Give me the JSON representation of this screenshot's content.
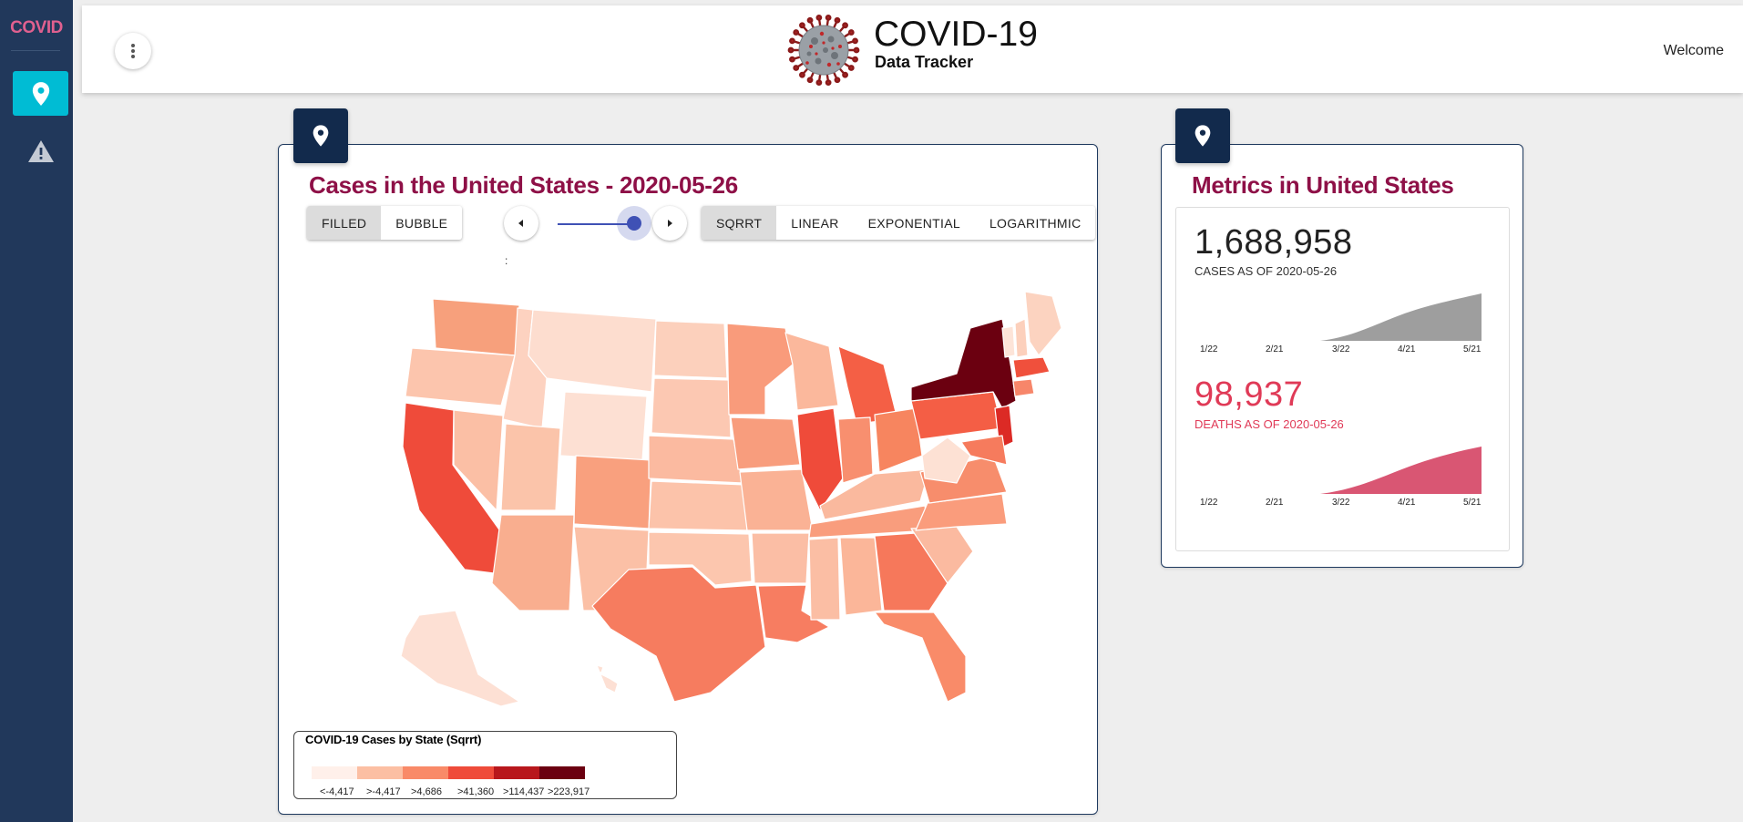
{
  "sidebar": {
    "brand": "COVID",
    "items": [
      {
        "icon": "map-pin-icon",
        "active": true
      },
      {
        "icon": "warning-icon",
        "active": false
      }
    ]
  },
  "header": {
    "title": "COVID-19",
    "subtitle": "Data Tracker",
    "welcome": "Welcome"
  },
  "map_card": {
    "title": "Cases in the United States - 2020-05-26",
    "type_buttons": [
      {
        "label": "FILLED",
        "selected": true
      },
      {
        "label": "BUBBLE",
        "selected": false
      }
    ],
    "scale_buttons": [
      {
        "label": "SQRRT",
        "selected": true
      },
      {
        "label": "LINEAR",
        "selected": false
      },
      {
        "label": "EXPONENTIAL",
        "selected": false
      },
      {
        "label": "LOGARITHMIC",
        "selected": false
      }
    ],
    "slider_marker": ":",
    "slider_value": 1.0,
    "legend": {
      "title": "COVID-19 Cases by State (Sqrrt)",
      "bins": [
        {
          "label": "<-4,417",
          "color": "#fff0ea"
        },
        {
          "label": ">-4,417",
          "color": "#fcbfa3"
        },
        {
          "label": ">4,686",
          "color": "#f98a68"
        },
        {
          "label": ">41,360",
          "color": "#ef4b3a"
        },
        {
          "label": ">114,437",
          "color": "#b8171c"
        },
        {
          "label": ">223,917",
          "color": "#6b0010"
        }
      ]
    }
  },
  "metrics_card": {
    "title": "Metrics in United States",
    "cases": {
      "value": "1,688,958",
      "label": "CASES AS OF 2020-05-26",
      "color": "#9e9e9e",
      "ticks": [
        "1/22",
        "2/21",
        "3/22",
        "4/21",
        "5/21"
      ]
    },
    "deaths": {
      "value": "98,937",
      "label": "DEATHS AS OF 2020-05-26",
      "color": "#d95673",
      "ticks": [
        "1/22",
        "2/21",
        "3/22",
        "4/21",
        "5/21"
      ]
    }
  }
}
